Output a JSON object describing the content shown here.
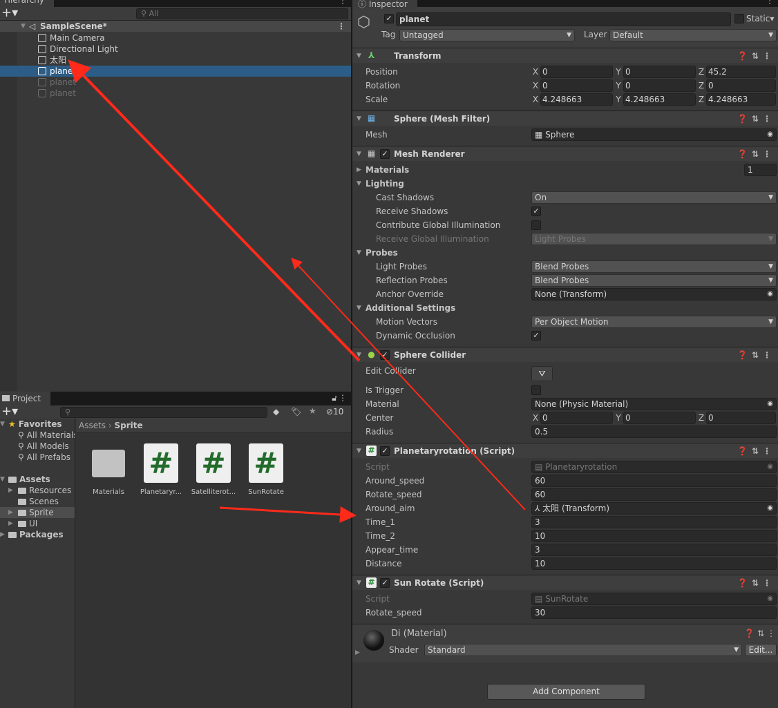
{
  "hierarchy": {
    "tab": "Hierarchy",
    "search_placeholder": "All",
    "scene": "SampleScene*",
    "items": [
      {
        "label": "Main Camera",
        "state": "normal"
      },
      {
        "label": "Directional Light",
        "state": "normal"
      },
      {
        "label": "太阳",
        "state": "normal"
      },
      {
        "label": "planet",
        "state": "selected"
      },
      {
        "label": "planet",
        "state": "disabled"
      },
      {
        "label": "planet",
        "state": "disabled"
      }
    ]
  },
  "project": {
    "tab": "Project",
    "hidden_count": "10",
    "breadcrumb": [
      "Assets",
      "Sprite"
    ],
    "tree": [
      {
        "label": "Favorites",
        "level": 0,
        "icon": "star"
      },
      {
        "label": "All Materials",
        "level": 1,
        "icon": "search"
      },
      {
        "label": "All Models",
        "level": 1,
        "icon": "search"
      },
      {
        "label": "All Prefabs",
        "level": 1,
        "icon": "search"
      },
      {
        "label": "",
        "level": 0,
        "icon": ""
      },
      {
        "label": "Assets",
        "level": 0,
        "icon": "folder-open"
      },
      {
        "label": "Resources",
        "level": 1,
        "icon": "folder"
      },
      {
        "label": "Scenes",
        "level": 1,
        "icon": "folder"
      },
      {
        "label": "Sprite",
        "level": 1,
        "icon": "folder",
        "selected": true
      },
      {
        "label": "UI",
        "level": 1,
        "icon": "folder"
      },
      {
        "label": "Packages",
        "level": 0,
        "icon": "folder"
      }
    ],
    "assets": [
      {
        "label": "Materials",
        "type": "folder"
      },
      {
        "label": "Planetaryr...",
        "type": "script"
      },
      {
        "label": "Satelliterot...",
        "type": "script"
      },
      {
        "label": "SunRotate",
        "type": "script"
      }
    ]
  },
  "inspector": {
    "tab": "Inspector",
    "object_name": "planet",
    "active": true,
    "static_label": "Static",
    "tag_label": "Tag",
    "tag": "Untagged",
    "layer_label": "Layer",
    "layer": "Default",
    "components": [
      {
        "name": "Transform",
        "icon": "transform",
        "rows": [
          {
            "t": "v3",
            "label": "Position",
            "x": "0",
            "y": "0",
            "z": "45.2"
          },
          {
            "t": "v3",
            "label": "Rotation",
            "x": "0",
            "y": "0",
            "z": "0"
          },
          {
            "t": "v3",
            "label": "Scale",
            "x": "4.248663",
            "y": "4.248663",
            "z": "4.248663"
          }
        ]
      },
      {
        "name": "Sphere (Mesh Filter)",
        "icon": "mesh-filter",
        "rows": [
          {
            "t": "obj",
            "label": "Mesh",
            "value": "Sphere"
          }
        ]
      },
      {
        "name": "Mesh Renderer",
        "icon": "mesh-renderer",
        "check": true,
        "rows": [
          {
            "t": "fold",
            "label": "Materials",
            "open": false,
            "count": "1"
          },
          {
            "t": "fold",
            "label": "Lighting",
            "open": true
          },
          {
            "t": "dd",
            "label": "Cast Shadows",
            "value": "On",
            "ind": true
          },
          {
            "t": "chk",
            "label": "Receive Shadows",
            "checked": true,
            "ind": true
          },
          {
            "t": "chk",
            "label": "Contribute Global Illumination",
            "checked": false,
            "ind": true
          },
          {
            "t": "dd",
            "label": "Receive Global Illumination",
            "value": "Light Probes",
            "ind": true,
            "dis": true
          },
          {
            "t": "fold",
            "label": "Probes",
            "open": true
          },
          {
            "t": "dd",
            "label": "Light Probes",
            "value": "Blend Probes",
            "ind": true
          },
          {
            "t": "dd",
            "label": "Reflection Probes",
            "value": "Blend Probes",
            "ind": true
          },
          {
            "t": "obj",
            "label": "Anchor Override",
            "value": "None (Transform)",
            "ind": true
          },
          {
            "t": "fold",
            "label": "Additional Settings",
            "open": true
          },
          {
            "t": "dd",
            "label": "Motion Vectors",
            "value": "Per Object Motion",
            "ind": true
          },
          {
            "t": "chk",
            "label": "Dynamic Occlusion",
            "checked": true,
            "ind": true
          }
        ]
      },
      {
        "name": "Sphere Collider",
        "icon": "sphere-collider",
        "check": true,
        "rows": [
          {
            "t": "btn",
            "label": "Edit Collider"
          },
          {
            "t": "chk",
            "label": "Is Trigger",
            "checked": false
          },
          {
            "t": "obj",
            "label": "Material",
            "value": "None (Physic Material)"
          },
          {
            "t": "v3",
            "label": "Center",
            "x": "0",
            "y": "0",
            "z": "0"
          },
          {
            "t": "txt",
            "label": "Radius",
            "value": "0.5"
          }
        ]
      },
      {
        "name": "Planetaryrotation (Script)",
        "icon": "script",
        "check": true,
        "rows": [
          {
            "t": "obj",
            "label": "Script",
            "value": "Planetaryrotation",
            "dis": true
          },
          {
            "t": "txt",
            "label": "Around_speed",
            "value": "60"
          },
          {
            "t": "txt",
            "label": "Rotate_speed",
            "value": "60"
          },
          {
            "t": "obj",
            "label": "Around_aim",
            "value": "太阳 (Transform)"
          },
          {
            "t": "txt",
            "label": "Time_1",
            "value": "3"
          },
          {
            "t": "txt",
            "label": "Time_2",
            "value": "10"
          },
          {
            "t": "txt",
            "label": "Appear_time",
            "value": "3"
          },
          {
            "t": "txt",
            "label": "Distance",
            "value": "10"
          }
        ]
      },
      {
        "name": "Sun Rotate (Script)",
        "icon": "script",
        "check": true,
        "rows": [
          {
            "t": "obj",
            "label": "Script",
            "value": "SunRotate",
            "dis": true
          },
          {
            "t": "txt",
            "label": "Rotate_speed",
            "value": "30"
          }
        ]
      }
    ],
    "material": {
      "name": "Di (Material)",
      "shader_label": "Shader",
      "shader": "Standard",
      "edit": "Edit..."
    },
    "add_component": "Add Component"
  },
  "annotation_color": "#ff2a1a"
}
